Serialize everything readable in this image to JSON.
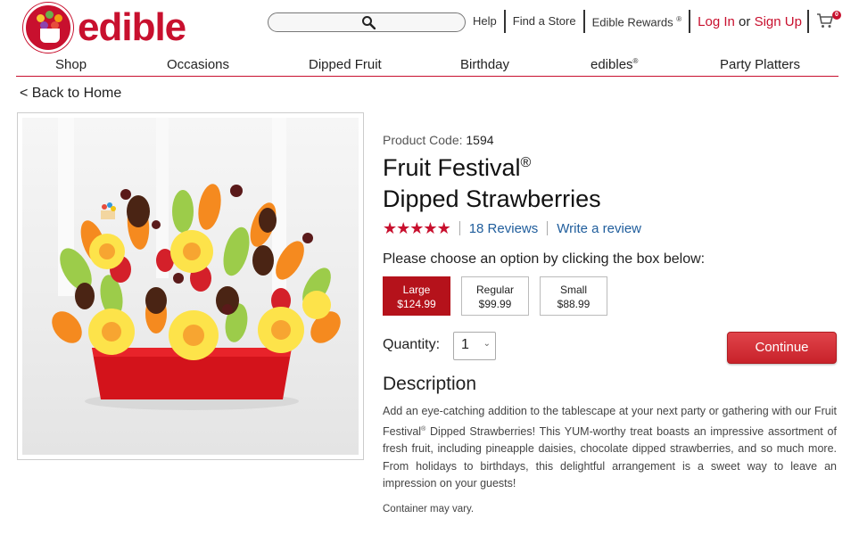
{
  "brand": {
    "name": "edible",
    "color": "#c8102e"
  },
  "search": {
    "placeholder": ""
  },
  "header": {
    "help": "Help",
    "find_store": "Find a Store",
    "rewards": "Edible Rewards",
    "rewards_mark": "®",
    "login": "Log In",
    "or": "or",
    "signup": "Sign Up",
    "cart_count": "0"
  },
  "nav": {
    "items": [
      {
        "label": "Shop"
      },
      {
        "label": "Occasions"
      },
      {
        "label": "Dipped Fruit"
      },
      {
        "label": "Birthday"
      },
      {
        "label": "edibles",
        "mark": "®"
      },
      {
        "label": "Party Platters"
      }
    ]
  },
  "back_link": "< Back to Home",
  "product": {
    "code_label": "Product Code:",
    "code": "1594",
    "title_line1": "Fruit Festival",
    "title_mark": "®",
    "title_line2": "Dipped Strawberries",
    "rating_stars": 5,
    "reviews": "18 Reviews",
    "write_review": "Write a review",
    "choose_prompt": "Please choose an option by clicking the box below:",
    "options": [
      {
        "name": "Large",
        "price": "$124.99",
        "selected": true
      },
      {
        "name": "Regular",
        "price": "$99.99",
        "selected": false
      },
      {
        "name": "Small",
        "price": "$88.99",
        "selected": false
      }
    ],
    "quantity_label": "Quantity:",
    "quantity": "1",
    "continue": "Continue",
    "description_heading": "Description",
    "description_a": "Add an eye-catching addition to the tablescape at your next party or gathering with our Fruit Festival",
    "description_mark": "®",
    "description_b": " Dipped Strawberries! This YUM-worthy treat boasts an impressive assortment of fresh fruit, including pineapple daisies, chocolate dipped strawberries, and so much more. From holidays to birthdays, this delightful arrangement is a sweet way to leave an impression on your guests!",
    "note": "Container may vary."
  },
  "icons": {
    "search": "search-icon",
    "cart": "cart-icon",
    "star": "star-icon",
    "chevron": "chevron-down-icon"
  }
}
